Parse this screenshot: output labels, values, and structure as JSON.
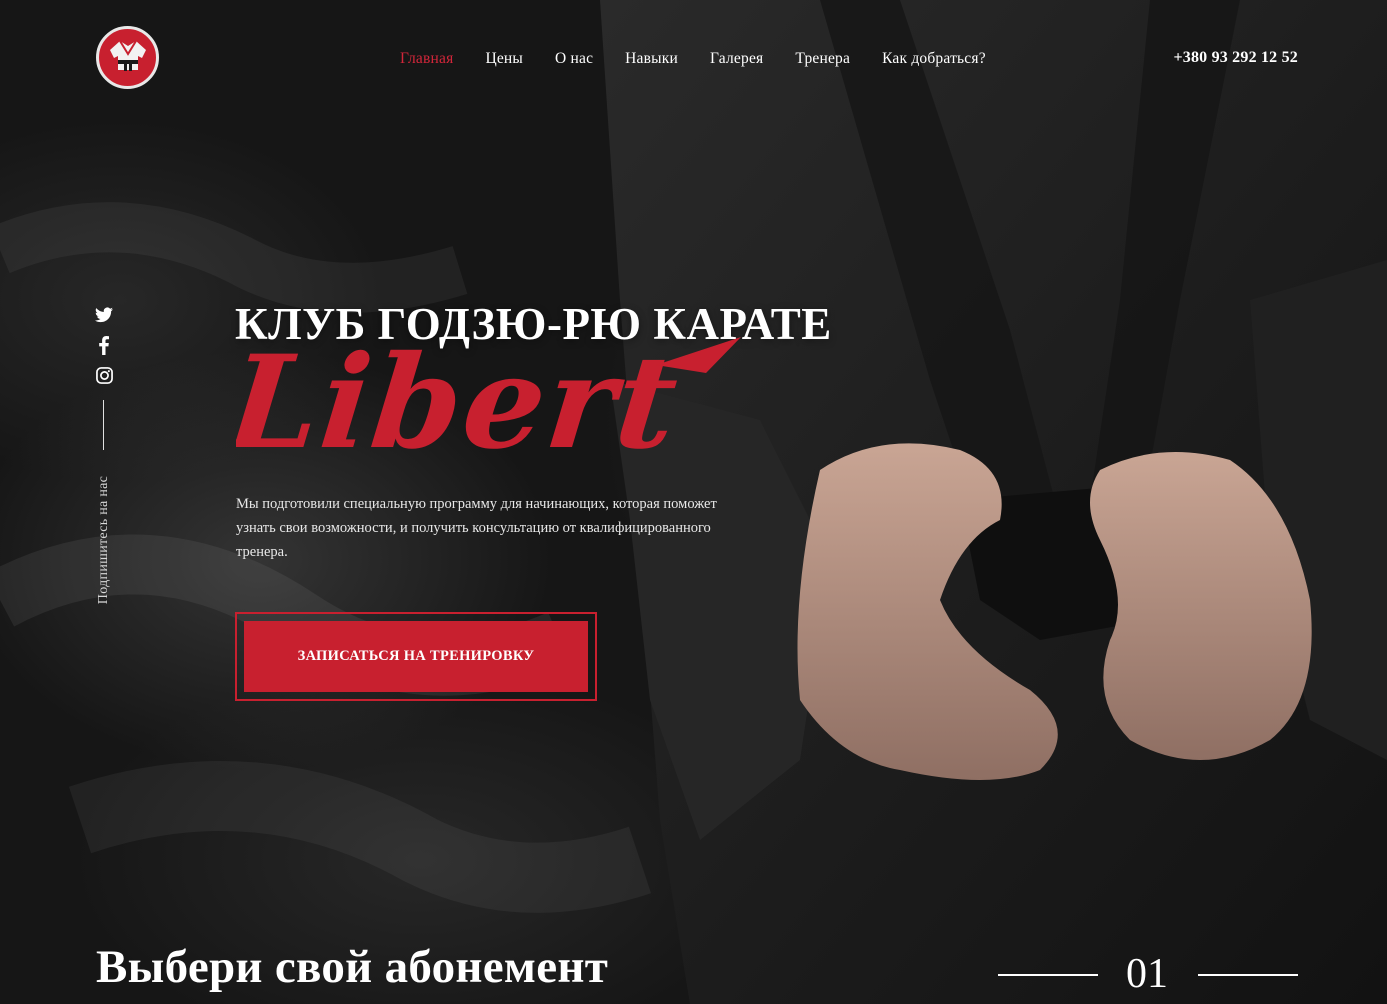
{
  "header": {
    "logo_icon": "karate-gi-logo-icon",
    "nav": [
      {
        "label": "Главная",
        "active": true
      },
      {
        "label": "Цены",
        "active": false
      },
      {
        "label": "О нас",
        "active": false
      },
      {
        "label": "Навыки",
        "active": false
      },
      {
        "label": "Галерея",
        "active": false
      },
      {
        "label": "Тренера",
        "active": false
      },
      {
        "label": "Как добраться?",
        "active": false
      }
    ],
    "phone": "+380 93 292 12 52"
  },
  "social": {
    "icons": [
      "twitter-icon",
      "facebook-icon",
      "instagram-icon"
    ],
    "subscribe_label": "Подпишитесь на нас"
  },
  "hero": {
    "title": "КЛУБ ГОДЗЮ-РЮ КАРАТЕ",
    "brand": "Libert",
    "description": "Мы подготовили специальную программу для начинающих, которая поможет узнать свои возможности, и получить консультацию от квалифицированного тренера.",
    "cta_label": "ЗАПИСАТЬСЯ НА ТРЕНИРОВКУ"
  },
  "section": {
    "title": "Выбери свой абонемент",
    "counter": "01"
  },
  "colors": {
    "accent": "#c8202f",
    "active_nav": "#d3263a",
    "background": "#1c1c1c",
    "text": "#ffffff"
  }
}
